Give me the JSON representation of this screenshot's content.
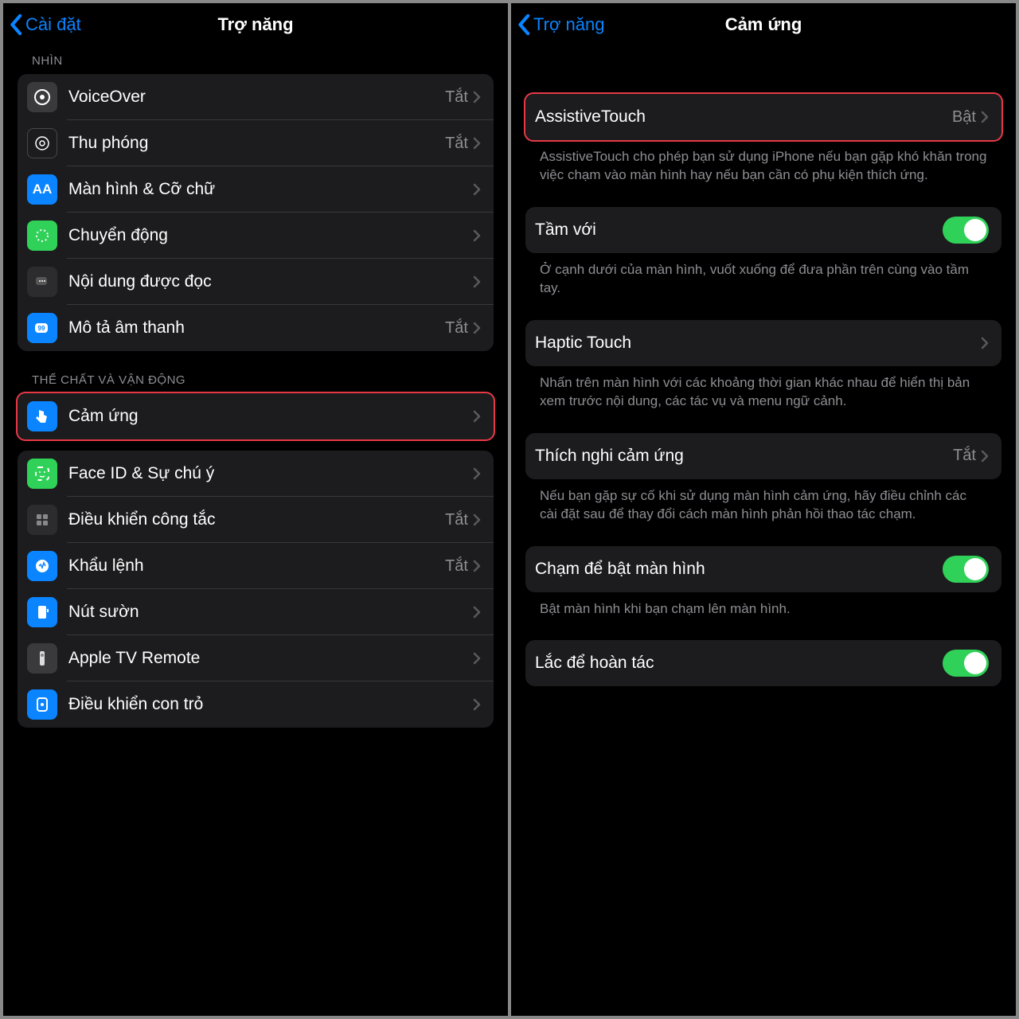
{
  "left": {
    "back": "Cài đặt",
    "title": "Trợ năng",
    "sectionVisionPartial": "NHÌN",
    "visionItems": [
      {
        "name": "voiceover",
        "label": "VoiceOver",
        "value": "Tắt"
      },
      {
        "name": "zoom",
        "label": "Thu phóng",
        "value": "Tắt"
      },
      {
        "name": "display",
        "label": "Màn hình & Cỡ chữ",
        "value": ""
      },
      {
        "name": "motion",
        "label": "Chuyển động",
        "value": ""
      },
      {
        "name": "spoken",
        "label": "Nội dung được đọc",
        "value": ""
      },
      {
        "name": "audiodesc",
        "label": "Mô tả âm thanh",
        "value": "Tắt"
      }
    ],
    "sectionPhysical": "THỂ CHẤT VÀ VẬN ĐỘNG",
    "touch": {
      "label": "Cảm ứng"
    },
    "physicalItems": [
      {
        "name": "faceid",
        "label": "Face ID & Sự chú ý",
        "value": ""
      },
      {
        "name": "switch",
        "label": "Điều khiển công tắc",
        "value": "Tắt"
      },
      {
        "name": "voicecontrol",
        "label": "Khẩu lệnh",
        "value": "Tắt"
      },
      {
        "name": "sidebutton",
        "label": "Nút sườn",
        "value": ""
      },
      {
        "name": "appletv",
        "label": "Apple TV Remote",
        "value": ""
      },
      {
        "name": "pointer",
        "label": "Điều khiển con trỏ",
        "value": ""
      }
    ]
  },
  "right": {
    "back": "Trợ năng",
    "title": "Cảm ứng",
    "assistive": {
      "label": "AssistiveTouch",
      "value": "Bật"
    },
    "assistiveDesc": "AssistiveTouch cho phép bạn sử dụng iPhone nếu bạn gặp khó khăn trong việc chạm vào màn hình hay nếu bạn cần có phụ kiện thích ứng.",
    "reach": {
      "label": "Tầm với"
    },
    "reachDesc": "Ở cạnh dưới của màn hình, vuốt xuống để đưa phần trên cùng vào tầm tay.",
    "haptic": {
      "label": "Haptic Touch"
    },
    "hapticDesc": "Nhấn trên màn hình với các khoảng thời gian khác nhau để hiển thị bản xem trước nội dung, các tác vụ và menu ngữ cảnh.",
    "accom": {
      "label": "Thích nghi cảm ứng",
      "value": "Tắt"
    },
    "accomDesc": "Nếu bạn gặp sự cố khi sử dụng màn hình cảm ứng, hãy điều chỉnh các cài đặt sau để thay đổi cách màn hình phản hồi thao tác chạm.",
    "tapwake": {
      "label": "Chạm để bật màn hình"
    },
    "tapwakeDesc": "Bật màn hình khi bạn chạm lên màn hình.",
    "shake": {
      "label": "Lắc để hoàn tác"
    }
  }
}
